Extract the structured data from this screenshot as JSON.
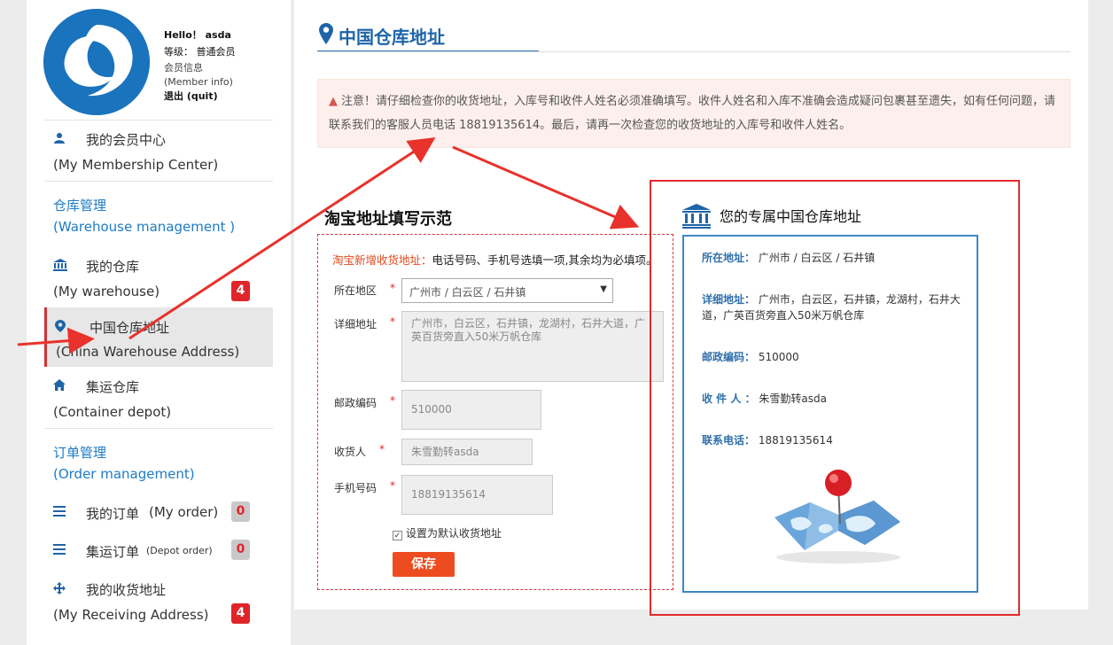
{
  "user": {
    "hello": "Hello！ asda",
    "level": "等级： 普通会员",
    "member_info_zh": "会员信息",
    "member_info_en": "(Member info)",
    "quit": "退出 (quit)"
  },
  "sidebar": {
    "items": [
      {
        "zh": "我的会员中心",
        "en": "(My Membership Center)",
        "icon": "user-icon"
      },
      {
        "zh": "仓库管理",
        "en": "(Warehouse management )",
        "heading": true
      },
      {
        "zh": "我的仓库",
        "en": "(My warehouse)",
        "icon": "bank-icon",
        "badge": "4"
      },
      {
        "zh": "中国仓库地址",
        "en": "(China Warehouse Address)",
        "icon": "map-pin-icon",
        "active": true
      },
      {
        "zh": "集运仓库",
        "en": "(Container depot)",
        "icon": "home-icon"
      },
      {
        "zh": "订单管理",
        "en": "(Order management)",
        "heading": true
      },
      {
        "zh": "我的订单",
        "en": "(My order)",
        "icon": "list-icon",
        "badge": "0"
      },
      {
        "zh": "集运订单",
        "en": "(Depot order)",
        "icon": "list-icon",
        "badge": "0"
      },
      {
        "zh": "我的收货地址",
        "en": "(My Receiving Address)",
        "icon": "move-icon",
        "badge": "4"
      }
    ]
  },
  "main": {
    "title": "中国仓库地址",
    "notice": "注意！请仔细检查你的收货地址，入库号和收件人姓名必须准确填写。收件人姓名和入库不准确会造成疑问包裹甚至遗失，如有任何问题，请联系我们的客服人员电话 18819135614。最后，请再一次检查您的收货地址的入库号和收件人姓名。",
    "example_title": "淘宝地址填写示范",
    "form": {
      "tip_red": "淘宝新增收货地址：",
      "tip_rest": "电话号码、手机号选填一项,其余均为必填项。",
      "region_label": "所在地区",
      "region_value": "广州市 / 白云区 / 石井镇",
      "detail_label": "详细地址",
      "detail_value": "广州市，白云区，石井镇，龙湖村，石井大道，广英百货旁直入50米万帆仓库",
      "zip_label": "邮政编码",
      "zip_value": "510000",
      "receiver_label": "收货人",
      "receiver_value": "朱雪勤转asda",
      "phone_label": "手机号码",
      "phone_value": "18819135614",
      "default_checkbox": "设置为默认收货地址",
      "save": "保存"
    },
    "address_card": {
      "title": "您的专属中国仓库地址",
      "region_label": "所在地址：",
      "region_value": "广州市 / 白云区 / 石井镇",
      "detail_label": "详细地址：",
      "detail_value": "广州市，白云区，石井镇，龙湖村，石井大道，广英百货旁直入50米万帆仓库",
      "zip_label": "邮政编码：",
      "zip_value": "510000",
      "receiver_label": "收 件 人 ：",
      "receiver_value": "朱雪勤转asda",
      "phone_label": "联系电话：",
      "phone_value": "18819135614"
    }
  },
  "colors": {
    "accent": "#1e64a8",
    "badge_red": "#e0252a",
    "save_button": "#ec4c20",
    "annotation_arrow": "#e8322b"
  }
}
